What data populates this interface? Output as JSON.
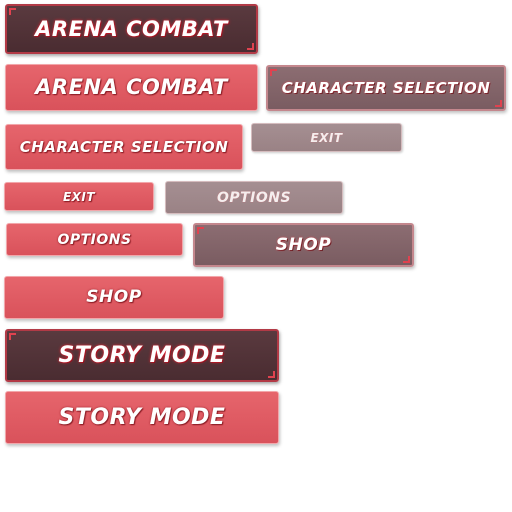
{
  "buttons": {
    "arena_combat_dark": "ARENA COMBAT",
    "arena_combat_red": "ARENA COMBAT",
    "character_selection_grey": "CHARACTER SELECTION",
    "character_selection_red": "CHARACTER SELECTION",
    "exit_pale": "EXIT",
    "exit_red": "EXIT",
    "options_pale": "OPTIONS",
    "options_red": "OPTIONS",
    "shop_grey": "SHOP",
    "shop_red": "SHOP",
    "story_mode_dark": "STORY MODE",
    "story_mode_red": "STORY MODE"
  },
  "colors": {
    "dark_fill": "#4f3136",
    "red_fill": "#df5b63",
    "grey_fill": "#82646a",
    "pale_fill": "#9f888b",
    "glow_red": "#e32636"
  }
}
